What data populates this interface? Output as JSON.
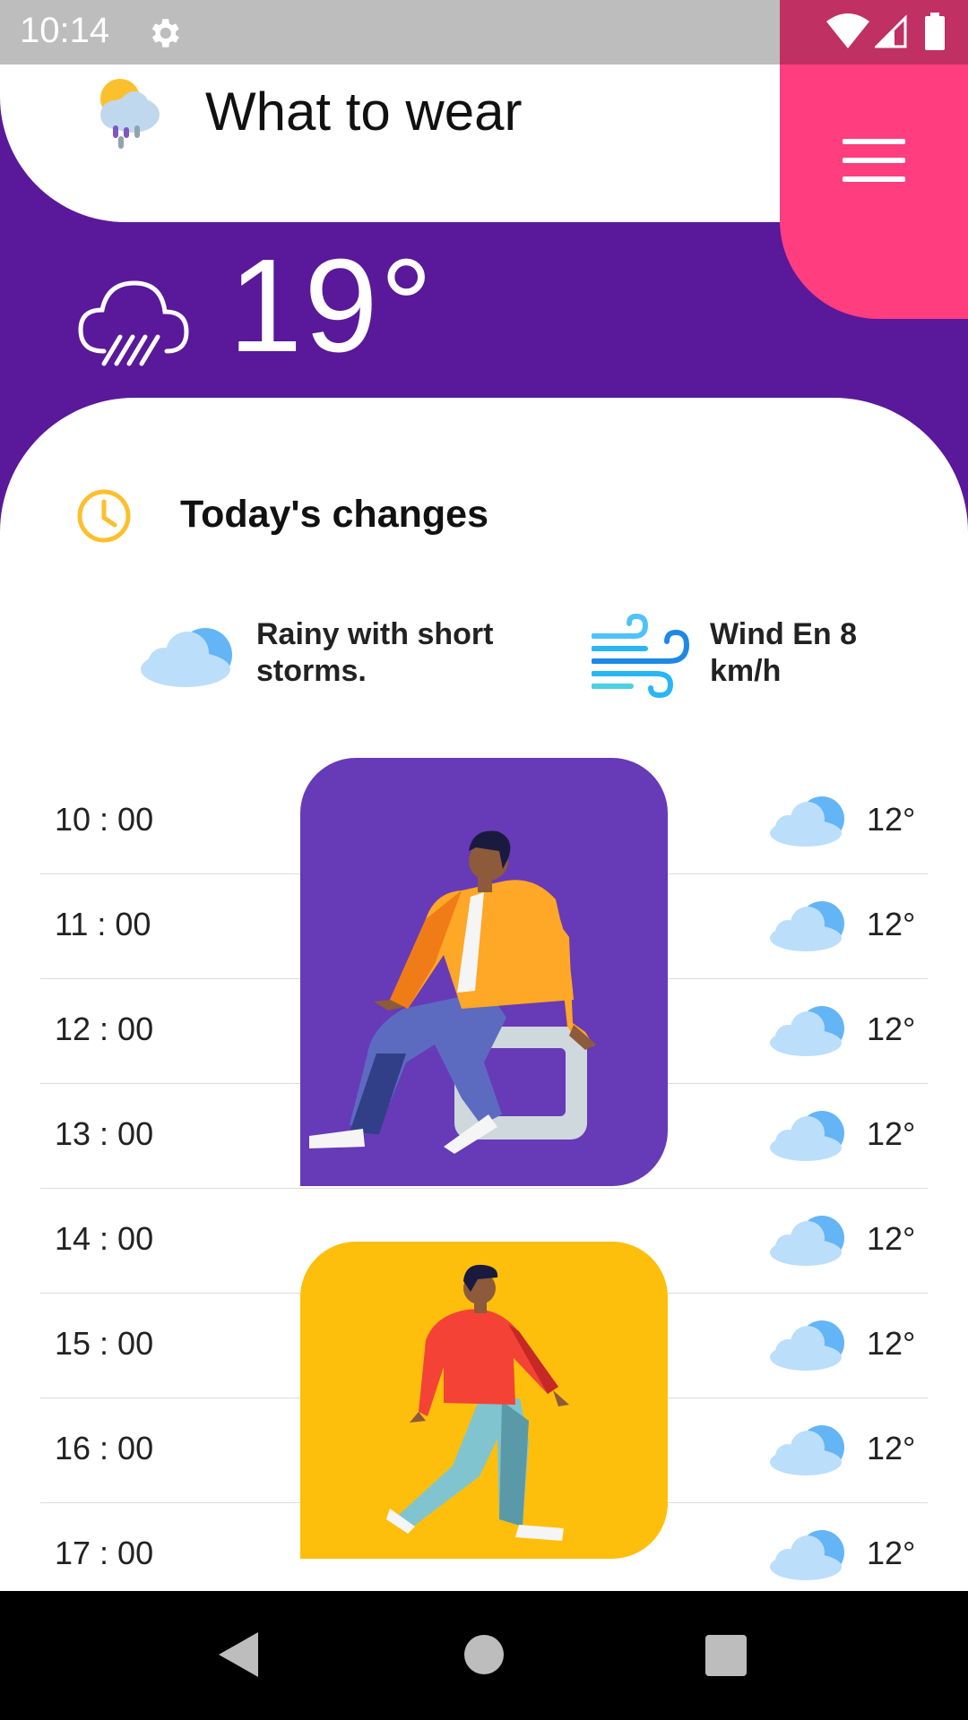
{
  "status_bar": {
    "time": "10:14"
  },
  "header": {
    "title": "What to wear"
  },
  "current": {
    "temperature": "19°"
  },
  "changes": {
    "title": "Today's changes",
    "condition": "Rainy with short storms.",
    "wind": "Wind En 8 km/h"
  },
  "hourly": [
    {
      "time": "10 : 00",
      "temp": "12°",
      "icon": "cloud-icon"
    },
    {
      "time": "11 : 00",
      "temp": "12°",
      "icon": "cloud-icon"
    },
    {
      "time": "12 : 00",
      "temp": "12°",
      "icon": "cloud-icon"
    },
    {
      "time": "13 : 00",
      "temp": "12°",
      "icon": "cloud-icon"
    },
    {
      "time": "14 : 00",
      "temp": "12°",
      "icon": "cloud-icon"
    },
    {
      "time": "15 : 00",
      "temp": "12°",
      "icon": "cloud-icon"
    },
    {
      "time": "16 : 00",
      "temp": "12°",
      "icon": "cloud-icon"
    },
    {
      "time": "17 : 00",
      "temp": "12°",
      "icon": "cloud-icon"
    }
  ],
  "colors": {
    "background_purple": "#5a189a",
    "menu_pink": "#ff3d7f",
    "outfit_purple": "#673ab7",
    "outfit_yellow": "#fdbf0b",
    "accent_yellow": "#fbc02d"
  }
}
